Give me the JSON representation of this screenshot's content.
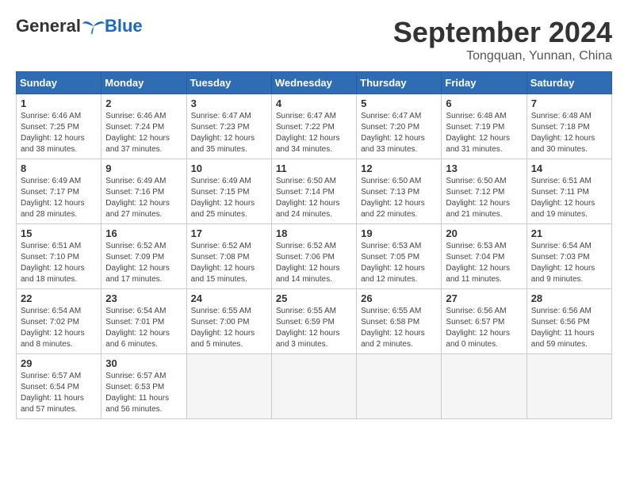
{
  "header": {
    "logo_general": "General",
    "logo_blue": "Blue",
    "month_title": "September 2024",
    "location": "Tongquan, Yunnan, China"
  },
  "weekdays": [
    "Sunday",
    "Monday",
    "Tuesday",
    "Wednesday",
    "Thursday",
    "Friday",
    "Saturday"
  ],
  "weeks": [
    [
      {
        "day": "1",
        "info": "Sunrise: 6:46 AM\nSunset: 7:25 PM\nDaylight: 12 hours and 38 minutes."
      },
      {
        "day": "2",
        "info": "Sunrise: 6:46 AM\nSunset: 7:24 PM\nDaylight: 12 hours and 37 minutes."
      },
      {
        "day": "3",
        "info": "Sunrise: 6:47 AM\nSunset: 7:23 PM\nDaylight: 12 hours and 35 minutes."
      },
      {
        "day": "4",
        "info": "Sunrise: 6:47 AM\nSunset: 7:22 PM\nDaylight: 12 hours and 34 minutes."
      },
      {
        "day": "5",
        "info": "Sunrise: 6:47 AM\nSunset: 7:20 PM\nDaylight: 12 hours and 33 minutes."
      },
      {
        "day": "6",
        "info": "Sunrise: 6:48 AM\nSunset: 7:19 PM\nDaylight: 12 hours and 31 minutes."
      },
      {
        "day": "7",
        "info": "Sunrise: 6:48 AM\nSunset: 7:18 PM\nDaylight: 12 hours and 30 minutes."
      }
    ],
    [
      {
        "day": "8",
        "info": "Sunrise: 6:49 AM\nSunset: 7:17 PM\nDaylight: 12 hours and 28 minutes."
      },
      {
        "day": "9",
        "info": "Sunrise: 6:49 AM\nSunset: 7:16 PM\nDaylight: 12 hours and 27 minutes."
      },
      {
        "day": "10",
        "info": "Sunrise: 6:49 AM\nSunset: 7:15 PM\nDaylight: 12 hours and 25 minutes."
      },
      {
        "day": "11",
        "info": "Sunrise: 6:50 AM\nSunset: 7:14 PM\nDaylight: 12 hours and 24 minutes."
      },
      {
        "day": "12",
        "info": "Sunrise: 6:50 AM\nSunset: 7:13 PM\nDaylight: 12 hours and 22 minutes."
      },
      {
        "day": "13",
        "info": "Sunrise: 6:50 AM\nSunset: 7:12 PM\nDaylight: 12 hours and 21 minutes."
      },
      {
        "day": "14",
        "info": "Sunrise: 6:51 AM\nSunset: 7:11 PM\nDaylight: 12 hours and 19 minutes."
      }
    ],
    [
      {
        "day": "15",
        "info": "Sunrise: 6:51 AM\nSunset: 7:10 PM\nDaylight: 12 hours and 18 minutes."
      },
      {
        "day": "16",
        "info": "Sunrise: 6:52 AM\nSunset: 7:09 PM\nDaylight: 12 hours and 17 minutes."
      },
      {
        "day": "17",
        "info": "Sunrise: 6:52 AM\nSunset: 7:08 PM\nDaylight: 12 hours and 15 minutes."
      },
      {
        "day": "18",
        "info": "Sunrise: 6:52 AM\nSunset: 7:06 PM\nDaylight: 12 hours and 14 minutes."
      },
      {
        "day": "19",
        "info": "Sunrise: 6:53 AM\nSunset: 7:05 PM\nDaylight: 12 hours and 12 minutes."
      },
      {
        "day": "20",
        "info": "Sunrise: 6:53 AM\nSunset: 7:04 PM\nDaylight: 12 hours and 11 minutes."
      },
      {
        "day": "21",
        "info": "Sunrise: 6:54 AM\nSunset: 7:03 PM\nDaylight: 12 hours and 9 minutes."
      }
    ],
    [
      {
        "day": "22",
        "info": "Sunrise: 6:54 AM\nSunset: 7:02 PM\nDaylight: 12 hours and 8 minutes."
      },
      {
        "day": "23",
        "info": "Sunrise: 6:54 AM\nSunset: 7:01 PM\nDaylight: 12 hours and 6 minutes."
      },
      {
        "day": "24",
        "info": "Sunrise: 6:55 AM\nSunset: 7:00 PM\nDaylight: 12 hours and 5 minutes."
      },
      {
        "day": "25",
        "info": "Sunrise: 6:55 AM\nSunset: 6:59 PM\nDaylight: 12 hours and 3 minutes."
      },
      {
        "day": "26",
        "info": "Sunrise: 6:55 AM\nSunset: 6:58 PM\nDaylight: 12 hours and 2 minutes."
      },
      {
        "day": "27",
        "info": "Sunrise: 6:56 AM\nSunset: 6:57 PM\nDaylight: 12 hours and 0 minutes."
      },
      {
        "day": "28",
        "info": "Sunrise: 6:56 AM\nSunset: 6:56 PM\nDaylight: 11 hours and 59 minutes."
      }
    ],
    [
      {
        "day": "29",
        "info": "Sunrise: 6:57 AM\nSunset: 6:54 PM\nDaylight: 11 hours and 57 minutes."
      },
      {
        "day": "30",
        "info": "Sunrise: 6:57 AM\nSunset: 6:53 PM\nDaylight: 11 hours and 56 minutes."
      },
      {
        "day": "",
        "info": ""
      },
      {
        "day": "",
        "info": ""
      },
      {
        "day": "",
        "info": ""
      },
      {
        "day": "",
        "info": ""
      },
      {
        "day": "",
        "info": ""
      }
    ]
  ]
}
